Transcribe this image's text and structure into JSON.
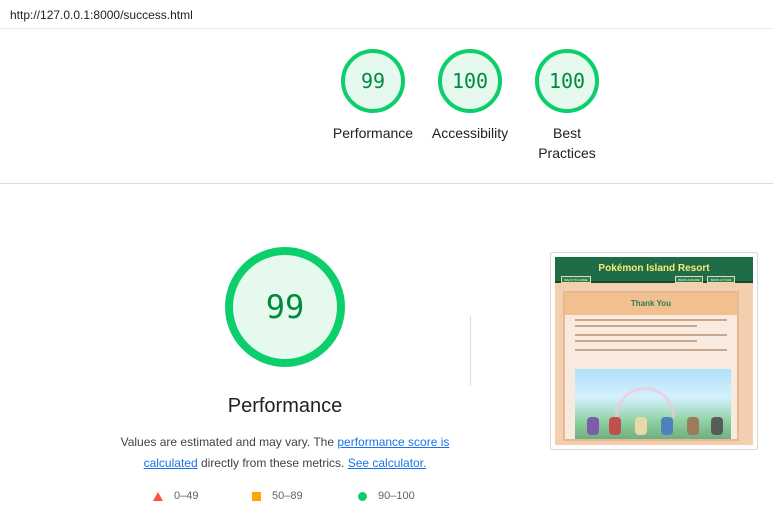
{
  "browser": {
    "url": "http://127.0.0.1:8000/success.html"
  },
  "summary": {
    "gauges": [
      {
        "score": "99",
        "label": "Performance"
      },
      {
        "score": "100",
        "label": "Accessibility"
      },
      {
        "score": "100",
        "label": "Best Practices"
      }
    ]
  },
  "performance": {
    "score": "99",
    "title": "Performance",
    "desc_prefix": "Values are estimated and may vary. The ",
    "score_link": "performance score is calculated",
    "desc_middle": " directly from these metrics. ",
    "calc_link": "See calculator."
  },
  "legend": [
    {
      "range": "0–49",
      "icon": "fail-triangle-icon",
      "color": "#ff4e42"
    },
    {
      "range": "50–89",
      "icon": "average-square-icon",
      "color": "#ffa400"
    },
    {
      "range": "90–100",
      "icon": "pass-circle-icon",
      "color": "#0cce6b"
    }
  ],
  "colors": {
    "pass": "#0cce6b",
    "pass_text": "#008a3b",
    "link": "#1a73e8"
  },
  "screenshot": {
    "site_title": "Pokémon Island Resort",
    "heading": "Thank You",
    "nav": [
      "BACK TO HOME",
      "BOOK A ROOM",
      "BOOK A TOUR"
    ]
  }
}
